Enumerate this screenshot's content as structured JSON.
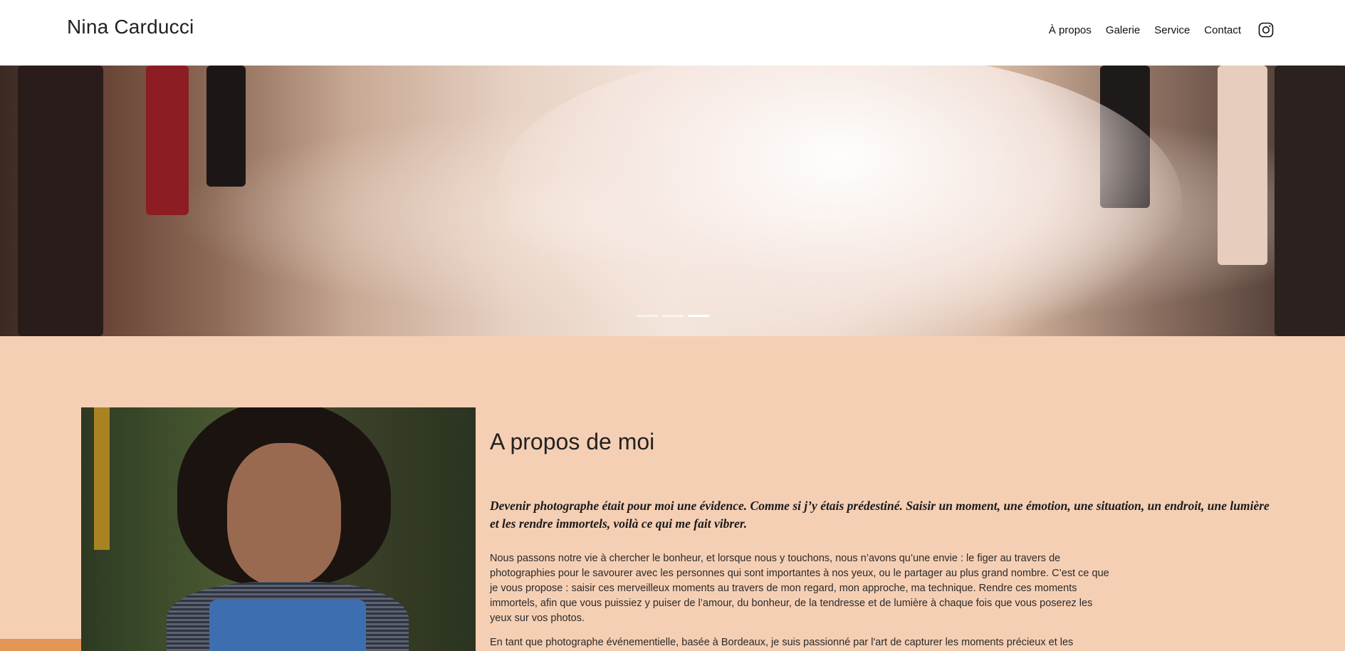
{
  "header": {
    "brand": "Nina Carducci",
    "nav": [
      "À propos",
      "Galerie",
      "Service",
      "Contact"
    ],
    "instagram_icon": "instagram-icon"
  },
  "hero": {
    "slides_count": 3,
    "active_slide": 3
  },
  "about": {
    "title": "A propos de moi",
    "lead": "Devenir photographe était pour moi une évidence. Comme si j’y étais prédestiné. Saisir un moment, une émotion, une situation, un endroit, une lumière et les rendre immortels, voilà ce qui me fait vibrer.",
    "paragraph1": "Nous passons notre vie à chercher le bonheur, et lorsque nous y touchons, nous n’avons qu’une envie : le figer au travers de photographies pour le savourer avec les personnes qui sont importantes à nos yeux, ou le partager au plus grand nombre. C’est ce que je vous propose : saisir ces merveilleux moments au travers de mon regard, mon approche, ma technique. Rendre ces moments immortels, afin que vous puissiez y puiser de l’amour, du bonheur, de la tendresse et de lumière à chaque fois que vous poserez les yeux sur vos photos.",
    "paragraph2": "En tant que photographe événementielle, basée à Bordeaux, je suis passionné par l'art de capturer les moments précieux et les"
  },
  "colors": {
    "section_bg": "#f5cfb4",
    "accent": "#e39556",
    "header_bg": "#ffffff"
  }
}
